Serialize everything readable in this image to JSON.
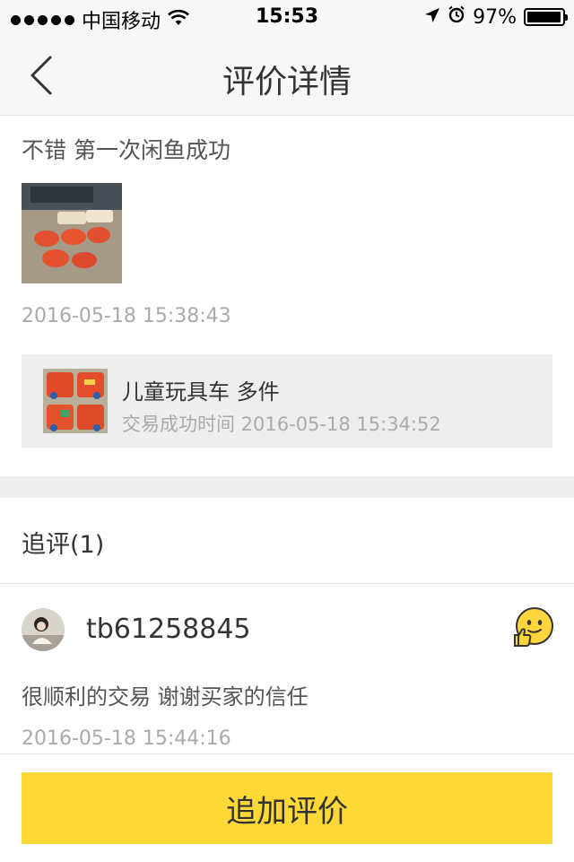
{
  "status_bar": {
    "carrier": "中国移动",
    "time": "15:53",
    "battery": "97%",
    "battery_level": 0.97
  },
  "nav": {
    "back_icon": "chevron-left-icon",
    "title": "评价详情"
  },
  "review": {
    "text": "不错 第一次闲鱼成功",
    "timestamp": "2016-05-18 15:38:43"
  },
  "item": {
    "name": "儿童玩具车 多件",
    "trade_time": "交易成功时间 2016-05-18 15:34:52"
  },
  "followup": {
    "header": "追评(1)",
    "username": "tb61258845",
    "emoji_icon": "thumbs-up-smiley-icon",
    "text": "很顺利的交易 谢谢买家的信任",
    "timestamp": "2016-05-18 15:44:16"
  },
  "actions": {
    "add_review": "追加评价"
  },
  "colors": {
    "accent": "#fdd836",
    "muted_text": "#aaaaaa",
    "card_bg": "#eeeeee"
  }
}
